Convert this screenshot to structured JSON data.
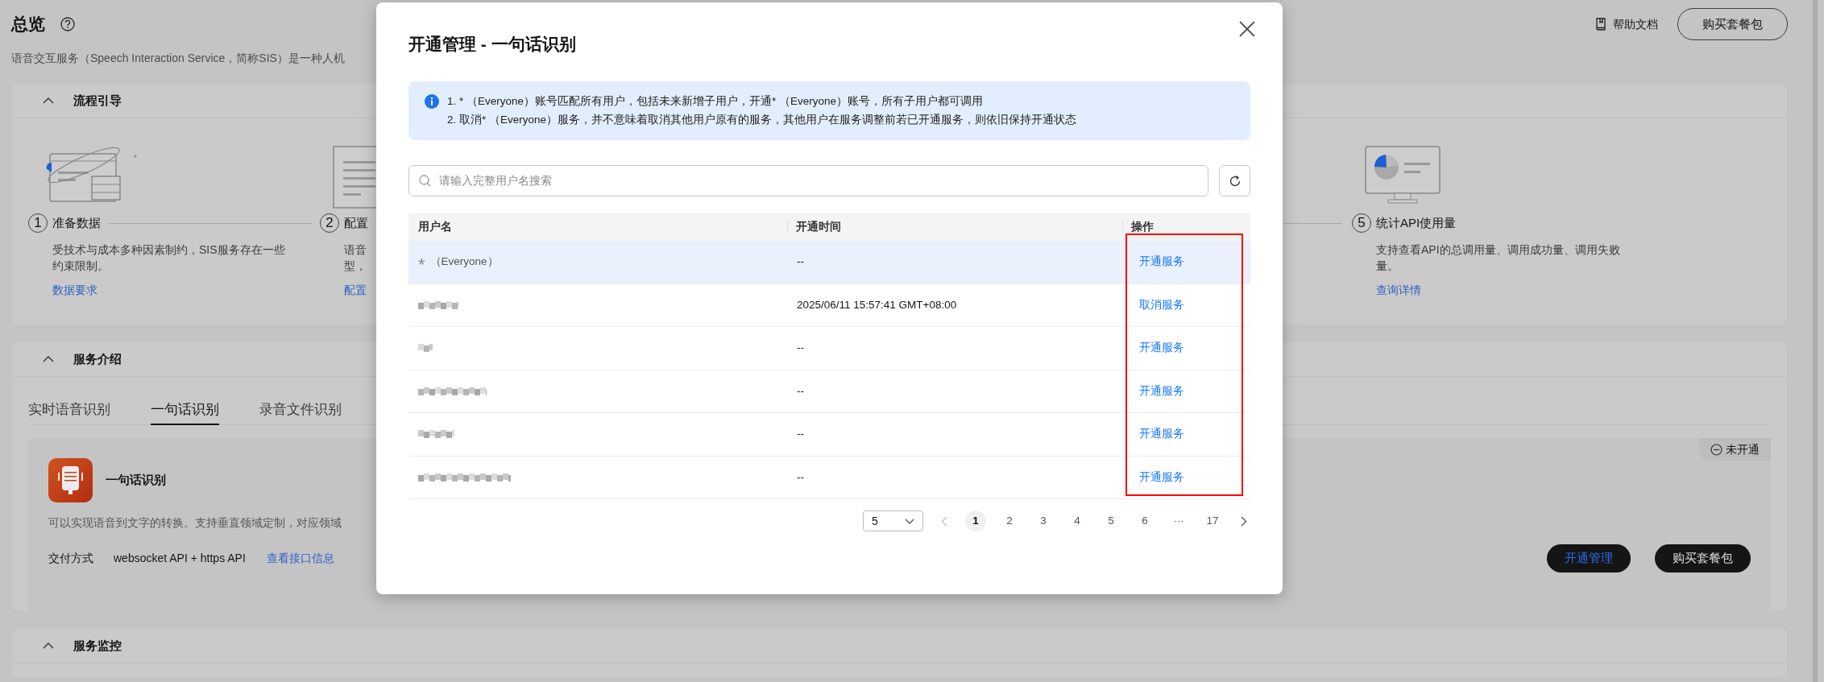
{
  "page": {
    "title": "总览",
    "description": "语音交互服务（Speech Interaction Service，简称SIS）是一种人机",
    "help_link": "帮助文档",
    "buy_button": "购买套餐包"
  },
  "sections": [
    {
      "kind": "steps",
      "title": "流程引导",
      "expanded": true,
      "steps": [
        {
          "number": "1",
          "title": "准备数据",
          "description_lines": [
            "受技术与成本多种因素制约，SIS服务存在一些",
            "约束限制。"
          ],
          "link": "数据要求",
          "kind": "browser"
        },
        {
          "number": "2",
          "title": "配置",
          "description_lines": [
            "语音",
            "型，"
          ],
          "link": "配置",
          "kind": "document"
        },
        {
          "number": "5",
          "title": "统计API使用量",
          "description_lines": [
            "支持查看API的总调用量、调用成功量、调用失败",
            "量。"
          ],
          "link": "查询详情",
          "kind": "monitor"
        }
      ]
    },
    {
      "kind": "service",
      "title": "服务介绍",
      "expanded": true,
      "tabs": [
        {
          "label": "实时语音识别",
          "selected": false
        },
        {
          "label": "一句话识别",
          "selected": true
        },
        {
          "label": "录音文件识别",
          "selected": false
        }
      ],
      "product": {
        "name": "一句话识别",
        "status": "未开通",
        "description": "可以实现语音到文字的转换。支持垂直领域定制，对应领域",
        "delivery_label": "交付方式",
        "delivery_value": "websocket API + https API",
        "api_link": "查看接口信息",
        "buttons": [
          {
            "label": "开通管理",
            "kind": "manage"
          },
          {
            "label": "购买套餐包",
            "kind": "buy"
          }
        ]
      }
    },
    {
      "kind": "header",
      "title": "服务监控",
      "expanded": true
    }
  ],
  "dialog": {
    "title": "开通管理 - 一句话识别",
    "notes": [
      "1. * （Everyone）账号匹配所有用户，包括未来新增子用户，开通* （Everyone）账号，所有子用户都可调用",
      "2. 取消* （Everyone）服务，并不意味着取消其他用户原有的服务，其他用户在服务调整前若已开通服务，则依旧保持开通状态"
    ],
    "search": {
      "placeholder": "请输入完整用户名搜索"
    },
    "table": {
      "columns": [
        "用户名",
        "开通时间",
        "操作"
      ],
      "highlight_actions": true,
      "rows": [
        {
          "kind": "everyone",
          "user": "*",
          "user_note": "（Everyone）",
          "time": "--",
          "action": "开通服务",
          "highlighted": true
        },
        {
          "kind": "redacted",
          "time": "2025/06/11 15:57:41 GMT+08:00",
          "action": "取消服务",
          "highlighted": false
        },
        {
          "kind": "redacted",
          "time": "--",
          "action": "开通服务",
          "highlighted": false
        },
        {
          "kind": "redacted",
          "time": "--",
          "action": "开通服务",
          "highlighted": false
        },
        {
          "kind": "redacted",
          "time": "--",
          "action": "开通服务",
          "highlighted": false
        },
        {
          "kind": "redacted",
          "time": "--",
          "action": "开通服务",
          "highlighted": false
        }
      ]
    },
    "pagination": {
      "page_size": "5",
      "prev_disabled": true,
      "pages": [
        {
          "label": "1",
          "selected": true
        },
        {
          "label": "2",
          "selected": false
        },
        {
          "label": "3",
          "selected": false
        },
        {
          "label": "4",
          "selected": false
        },
        {
          "label": "5",
          "selected": false
        },
        {
          "label": "6",
          "selected": false
        },
        {
          "label": "···",
          "selected": false
        },
        {
          "label": "17",
          "selected": false
        }
      ]
    }
  }
}
